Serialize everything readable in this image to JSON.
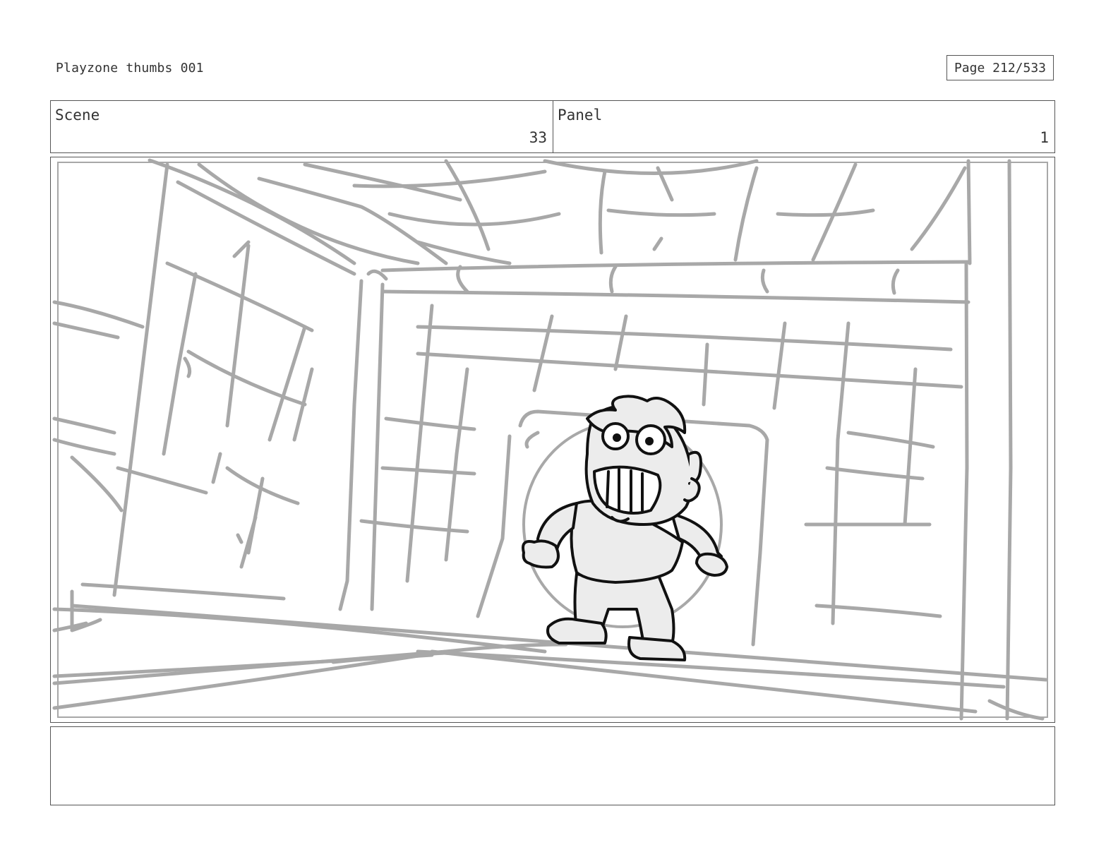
{
  "header": {
    "document_title": "Playzone thumbs 001",
    "page_label": "Page 212/533"
  },
  "info": {
    "scene_label": "Scene",
    "scene_value": "33",
    "panel_label": "Panel",
    "panel_value": "1"
  },
  "notes": {
    "text": ""
  },
  "colors": {
    "border": "#555555",
    "sketch_gray": "#a8a8a8",
    "ink": "#111111",
    "fill": "#ececec"
  }
}
